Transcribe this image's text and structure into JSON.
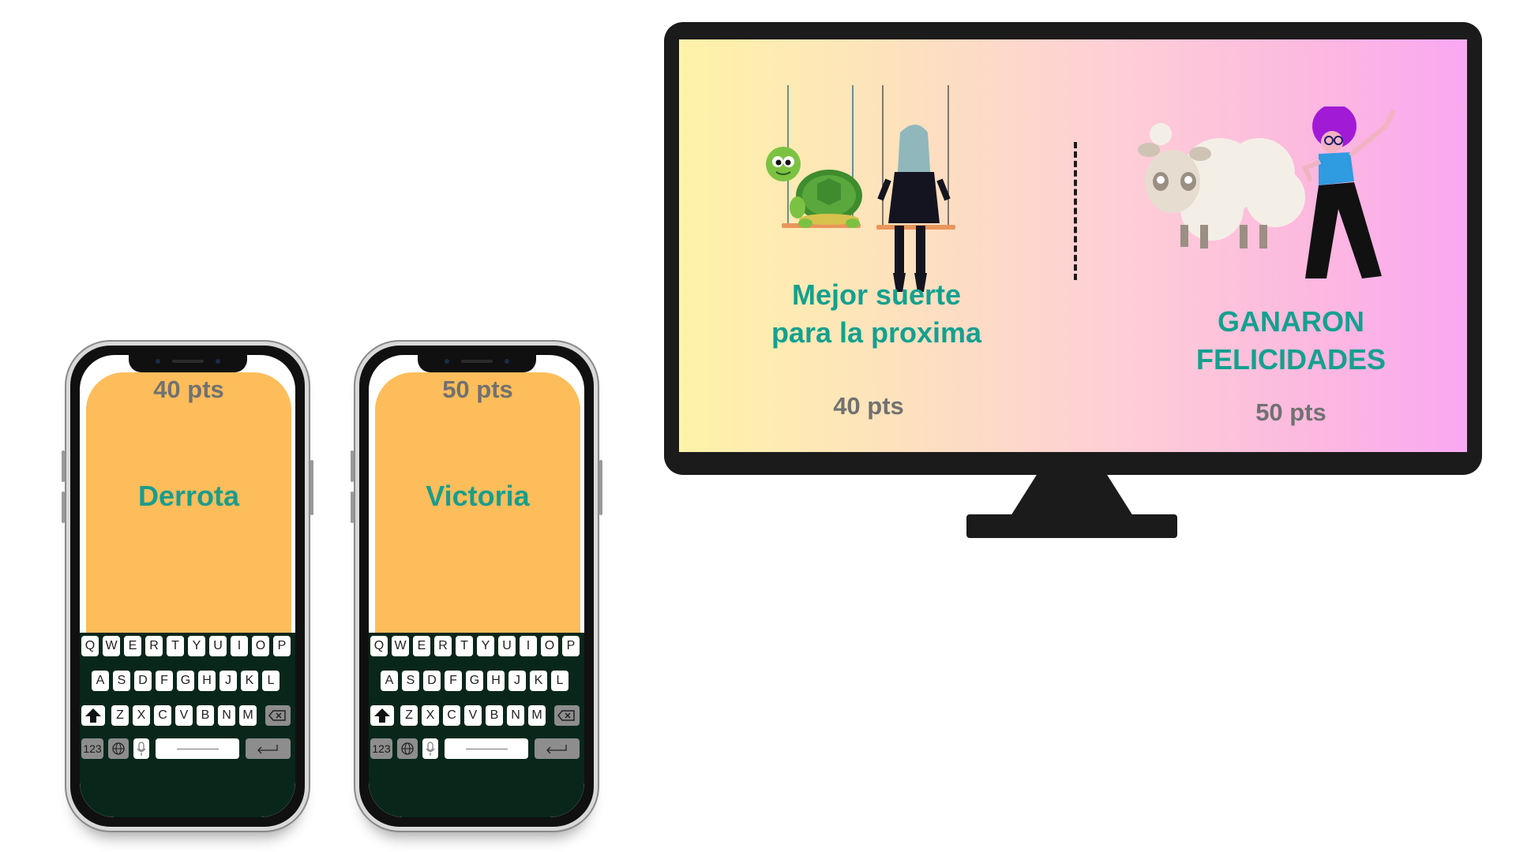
{
  "phones": [
    {
      "points": "40 pts",
      "result": "Derrota",
      "result_color": "#1a9c8c",
      "card_color": "#fdbd5b",
      "keyboard_color": "#08271a"
    },
    {
      "points": "50 pts",
      "result": "Victoria",
      "result_color": "#1a9c8c",
      "card_color": "#fdbd5b",
      "keyboard_color": "#08271a"
    }
  ],
  "keyboard": {
    "row1": [
      "Q",
      "W",
      "E",
      "R",
      "T",
      "Y",
      "U",
      "I",
      "O",
      "P"
    ],
    "row2": [
      "A",
      "S",
      "D",
      "F",
      "G",
      "H",
      "J",
      "K",
      "L"
    ],
    "row3": [
      "Z",
      "X",
      "C",
      "V",
      "B",
      "N",
      "M"
    ],
    "shift_icon": "shift-arrow-icon",
    "backspace_icon": "backspace-icon",
    "numbers_label": "123",
    "globe_icon": "globe-icon",
    "mic_icon": "microphone-icon",
    "return_icon": "return-arrow-icon"
  },
  "tv": {
    "left": {
      "line1": "Mejor suerte",
      "line2": "para la proxima",
      "points": "40 pts",
      "illustration": "turtle-and-girl-on-swings"
    },
    "right": {
      "line1": "GANARON",
      "line2": "FELICIDADES",
      "points": "50 pts",
      "illustration": "sheep-and-dancing-person"
    },
    "text_color": "#14a08f",
    "points_color": "#717171"
  }
}
